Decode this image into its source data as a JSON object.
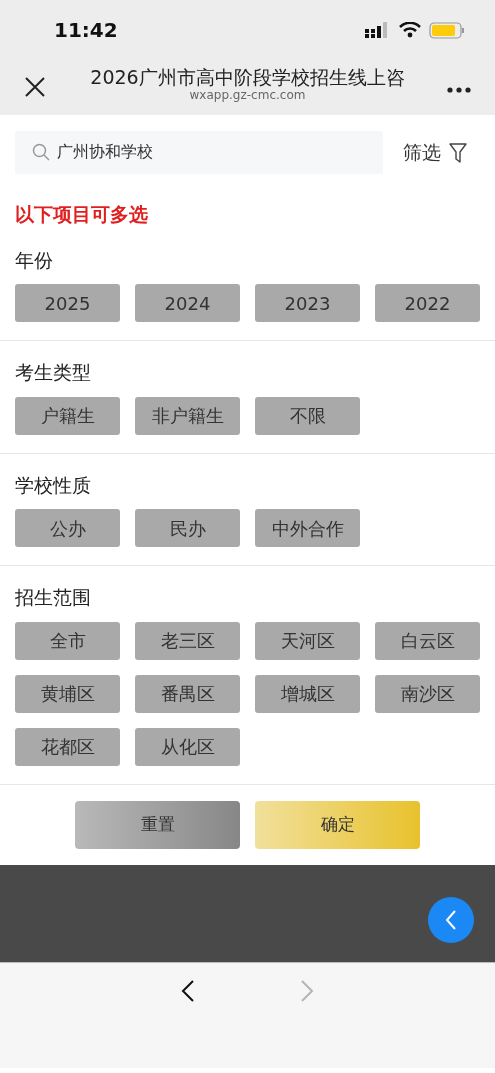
{
  "status_bar": {
    "time": "11:42"
  },
  "nav_bar": {
    "title": "2026广州市高中阶段学校招生线上咨",
    "url": "wxapp.gz-cmc.com"
  },
  "search": {
    "value": "广州协和学校",
    "filter_label": "筛选"
  },
  "hint": "以下项目可多选",
  "sections": [
    {
      "title": "年份",
      "options": [
        {
          "label": "2025",
          "selected": false
        },
        {
          "label": "2024",
          "selected": false
        },
        {
          "label": "2023",
          "selected": false
        },
        {
          "label": "2022",
          "selected": false
        }
      ]
    },
    {
      "title": "考生类型",
      "options": [
        {
          "label": "户籍生",
          "selected": false
        },
        {
          "label": "非户籍生",
          "selected": false
        },
        {
          "label": "不限",
          "selected": false
        }
      ]
    },
    {
      "title": "学校性质",
      "options": [
        {
          "label": "公办",
          "selected": false
        },
        {
          "label": "民办",
          "selected": false
        },
        {
          "label": "中外合作",
          "selected": false
        }
      ]
    },
    {
      "title": "招生范围",
      "options": [
        {
          "label": "全市",
          "selected": false
        },
        {
          "label": "老三区",
          "selected": false
        },
        {
          "label": "天河区",
          "selected": false
        },
        {
          "label": "白云区",
          "selected": false
        },
        {
          "label": "黄埔区",
          "selected": false
        },
        {
          "label": "番禺区",
          "selected": false
        },
        {
          "label": "增城区",
          "selected": false
        },
        {
          "label": "南沙区",
          "selected": false
        },
        {
          "label": "花都区",
          "selected": false
        },
        {
          "label": "从化区",
          "selected": false
        }
      ]
    }
  ],
  "actions": [
    {
      "label": "重置",
      "kind": "reset"
    },
    {
      "label": "确定",
      "kind": "confirm"
    }
  ],
  "browser_nav": {
    "back_disabled": false,
    "forward_disabled": true
  }
}
